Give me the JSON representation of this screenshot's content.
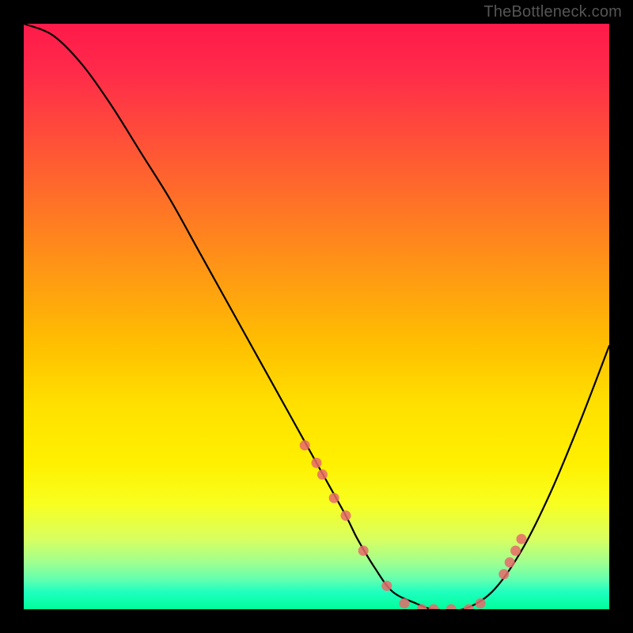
{
  "watermark": "TheBottleneck.com",
  "chart_data": {
    "type": "line",
    "title": "",
    "xlabel": "",
    "ylabel": "",
    "xlim": [
      0,
      100
    ],
    "ylim": [
      0,
      100
    ],
    "x": [
      0,
      5,
      10,
      15,
      20,
      25,
      30,
      35,
      40,
      45,
      50,
      55,
      57,
      60,
      63,
      67,
      70,
      75,
      80,
      85,
      90,
      95,
      100
    ],
    "values": [
      100,
      98,
      93,
      86,
      78,
      70,
      61,
      52,
      43,
      34,
      25,
      16,
      12,
      7,
      3,
      1,
      0,
      0,
      3,
      10,
      20,
      32,
      45
    ],
    "markers": {
      "x": [
        48,
        50,
        51,
        53,
        55,
        58,
        62,
        65,
        68,
        70,
        73,
        76,
        78,
        82,
        83,
        84,
        85
      ],
      "y": [
        28,
        25,
        23,
        19,
        16,
        10,
        4,
        1,
        0,
        0,
        0,
        0,
        1,
        6,
        8,
        10,
        12
      ]
    },
    "gradient_stops": [
      {
        "pos": 0,
        "color": "#ff1a4a"
      },
      {
        "pos": 50,
        "color": "#ffc000"
      },
      {
        "pos": 85,
        "color": "#f8ff20"
      },
      {
        "pos": 100,
        "color": "#00ff9a"
      }
    ]
  }
}
